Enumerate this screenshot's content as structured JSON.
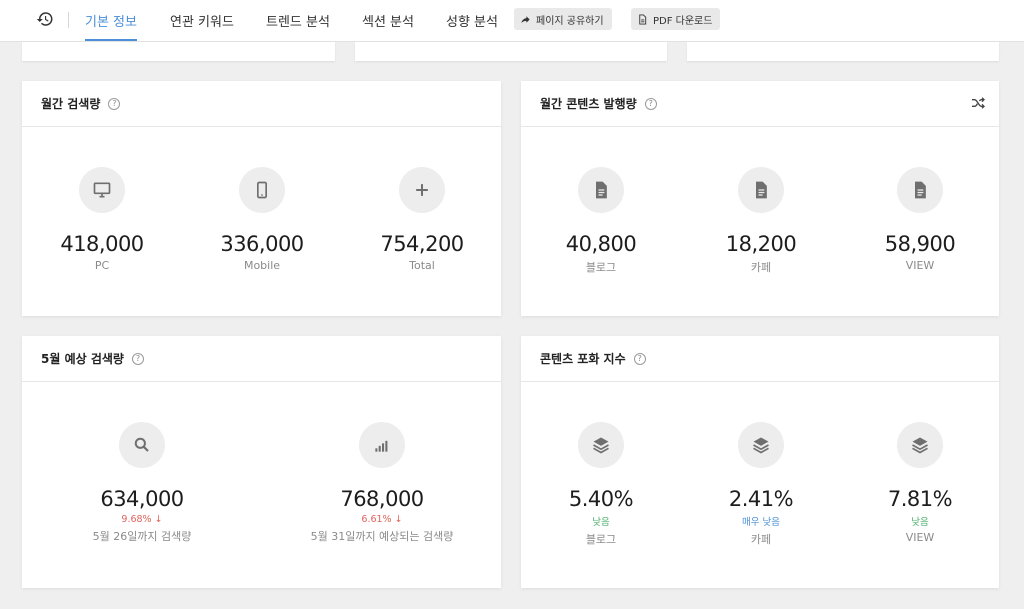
{
  "nav": {
    "tabs": [
      {
        "label": "기본 정보",
        "active": true
      },
      {
        "label": "연관 키워드"
      },
      {
        "label": "트렌드 분석"
      },
      {
        "label": "섹션 분석"
      },
      {
        "label": "성향 분석"
      }
    ],
    "share_label": "페이지 공유하기",
    "pdf_label": "PDF 다운로드"
  },
  "colors": {
    "accent": "#4a8fd8",
    "decrease": "#e0625c",
    "low": "#4caf6d",
    "very_low": "#4a8fd8"
  },
  "monthly_search": {
    "title": "월간 검색량",
    "items": [
      {
        "icon": "monitor-icon",
        "value": "418,000",
        "label": "PC"
      },
      {
        "icon": "smartphone-icon",
        "value": "336,000",
        "label": "Mobile"
      },
      {
        "icon": "plus-icon",
        "value": "754,200",
        "label": "Total"
      }
    ]
  },
  "monthly_content": {
    "title": "월간 콘텐츠 발행량",
    "items": [
      {
        "icon": "document-icon",
        "value": "40,800",
        "label": "블로그"
      },
      {
        "icon": "document-icon",
        "value": "18,200",
        "label": "카페"
      },
      {
        "icon": "document-icon",
        "value": "58,900",
        "label": "VIEW"
      }
    ]
  },
  "forecast": {
    "title": "5월 예상 검색량",
    "items": [
      {
        "icon": "search-icon",
        "value": "634,000",
        "change": "9.68%",
        "label": "5월 26일까지 검색량"
      },
      {
        "icon": "signal-bars-icon",
        "value": "768,000",
        "change": "6.61%",
        "label": "5월 31일까지 예상되는 검색량"
      }
    ]
  },
  "saturation": {
    "title": "콘텐츠 포화 지수",
    "items": [
      {
        "icon": "layers-icon",
        "value": "5.40%",
        "level": "낮음",
        "label": "블로그"
      },
      {
        "icon": "layers-icon",
        "value": "2.41%",
        "level": "매우 낮음",
        "label": "카페"
      },
      {
        "icon": "layers-icon",
        "value": "7.81%",
        "level": "낮음",
        "label": "VIEW"
      }
    ]
  }
}
